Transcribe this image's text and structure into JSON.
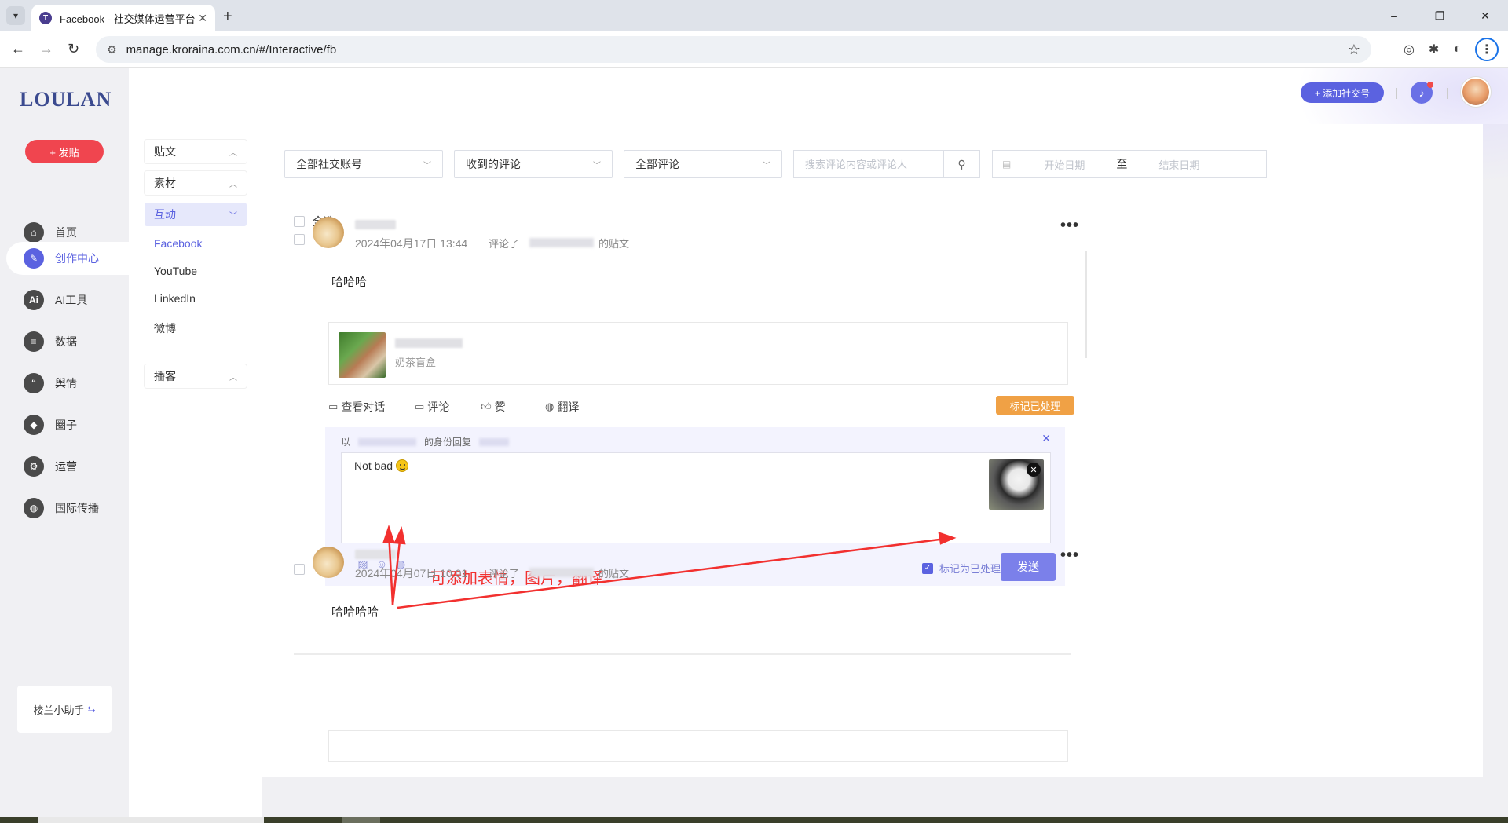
{
  "browser": {
    "tab_title": "Facebook - 社交媒体运营平台",
    "tab_favicon": "T",
    "new_tab": "+",
    "url": "manage.kroraina.com.cn/#/Interactive/fb",
    "win_minimize": "–",
    "win_restore": "❐",
    "win_close": "✕"
  },
  "app": {
    "logo": "LOULAN",
    "post_button": "+ 发贴",
    "nav": [
      {
        "label": "首页",
        "icon": "home-icon",
        "glyph": "⌂"
      },
      {
        "label": "创作中心",
        "icon": "palette-icon",
        "glyph": "✎"
      },
      {
        "label": "AI工具",
        "icon": "ai-icon",
        "glyph": "Ai"
      },
      {
        "label": "数据",
        "icon": "database-icon",
        "glyph": "≡"
      },
      {
        "label": "舆情",
        "icon": "quote-icon",
        "glyph": "“"
      },
      {
        "label": "圈子",
        "icon": "compass-icon",
        "glyph": "◆"
      },
      {
        "label": "运营",
        "icon": "network-icon",
        "glyph": "⚙"
      },
      {
        "label": "国际传播",
        "icon": "globe-icon",
        "glyph": "◍"
      }
    ],
    "helper_label": "楼兰小助手",
    "helper_icon": "⇆",
    "accent_color": "#5b62e0"
  },
  "submenu": {
    "groups": [
      {
        "label": "贴文"
      },
      {
        "label": "素材"
      },
      {
        "label": "互动"
      },
      {
        "label": "播客"
      }
    ],
    "links": [
      "Facebook",
      "YouTube",
      "LinkedIn",
      "微博"
    ]
  },
  "header": {
    "add_social": "+ 添加社交号"
  },
  "filters": {
    "account": "全部社交账号",
    "type": "收到的评论",
    "scope": "全部评论",
    "search_placeholder": "搜索评论内容或评论人",
    "start_date": "开始日期",
    "date_sep": "至",
    "end_date": "结束日期"
  },
  "select_all": "全选",
  "comments": [
    {
      "time": "2024年04月17日 13:44",
      "commented": "评论了",
      "post_suffix": "的贴文",
      "text": "哈哈哈",
      "post_name": "奶茶盲盒"
    },
    {
      "time": "2024年04月07日 10:01",
      "commented": "评论了",
      "post_suffix": "的贴文",
      "text": "哈哈哈哈"
    }
  ],
  "actions": {
    "view_conversation": "查看对话",
    "comment": "评论",
    "like": "赞",
    "translate": "翻译",
    "mark_processed": "标记已处理"
  },
  "reply": {
    "prefix": "以",
    "identity": "的身份回复",
    "text": "Not bad",
    "mark_label": "标记为已处理",
    "send": "发送",
    "annotation": "可添加表情，图片，翻译"
  }
}
